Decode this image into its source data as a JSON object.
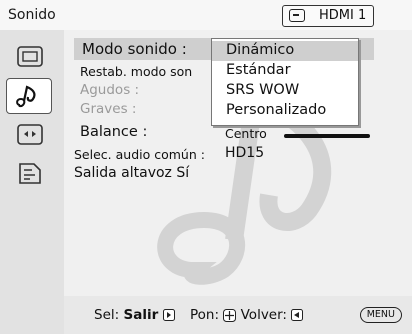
{
  "header": {
    "title": "Sonido",
    "input": "HDMI 1"
  },
  "sidebar": {
    "items": [
      {
        "icon": "picture-icon",
        "active": false
      },
      {
        "icon": "music-note-icon",
        "active": true
      },
      {
        "icon": "screen-icon",
        "active": false
      },
      {
        "icon": "settings-icon",
        "active": false
      }
    ]
  },
  "menu": {
    "sound_mode_label": "Modo sonido :",
    "reset_label": "Restab. modo son",
    "treble_label": "Agudos :",
    "bass_label": "Graves :",
    "balance_label": "Balance :",
    "balance_value": "Centro",
    "common_audio_label": "Selec. audio común :",
    "common_audio_value": "HD15",
    "speaker_out_label": "Salida altavoz Sí"
  },
  "dropdown": {
    "options": [
      "Dinámico",
      "Estándar",
      "SRS WOW",
      "Personalizado"
    ],
    "selected": "Dinámico"
  },
  "footer": {
    "select_label": "Sel:",
    "select_key": "Salir",
    "set_label": "Pon:",
    "back_label": "Volver:",
    "menu_key": "MENU"
  }
}
